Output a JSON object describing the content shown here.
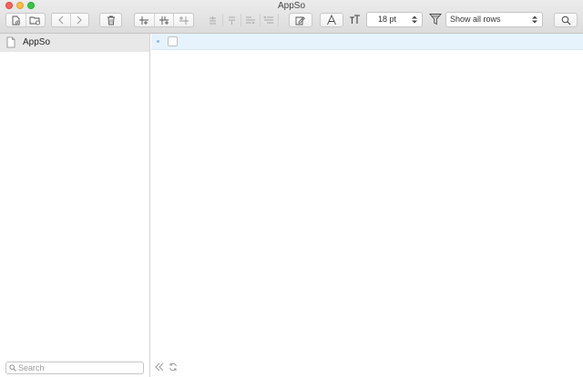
{
  "window": {
    "title": "AppSo"
  },
  "toolbar": {
    "font_size": "18 pt",
    "row_filter": "Show all rows"
  },
  "sidebar": {
    "items": [
      {
        "label": "AppSo",
        "icon": "document-icon",
        "selected": true
      }
    ],
    "search": {
      "placeholder": "Search"
    }
  },
  "outline": {
    "rows": [
      {
        "text": "",
        "checked": false
      }
    ]
  },
  "colors": {
    "selection": "#e8e8e8",
    "row_highlight": "#e6f3fd",
    "close": "#fc605c",
    "minimize": "#fdbc40",
    "maximize": "#34c84a"
  }
}
